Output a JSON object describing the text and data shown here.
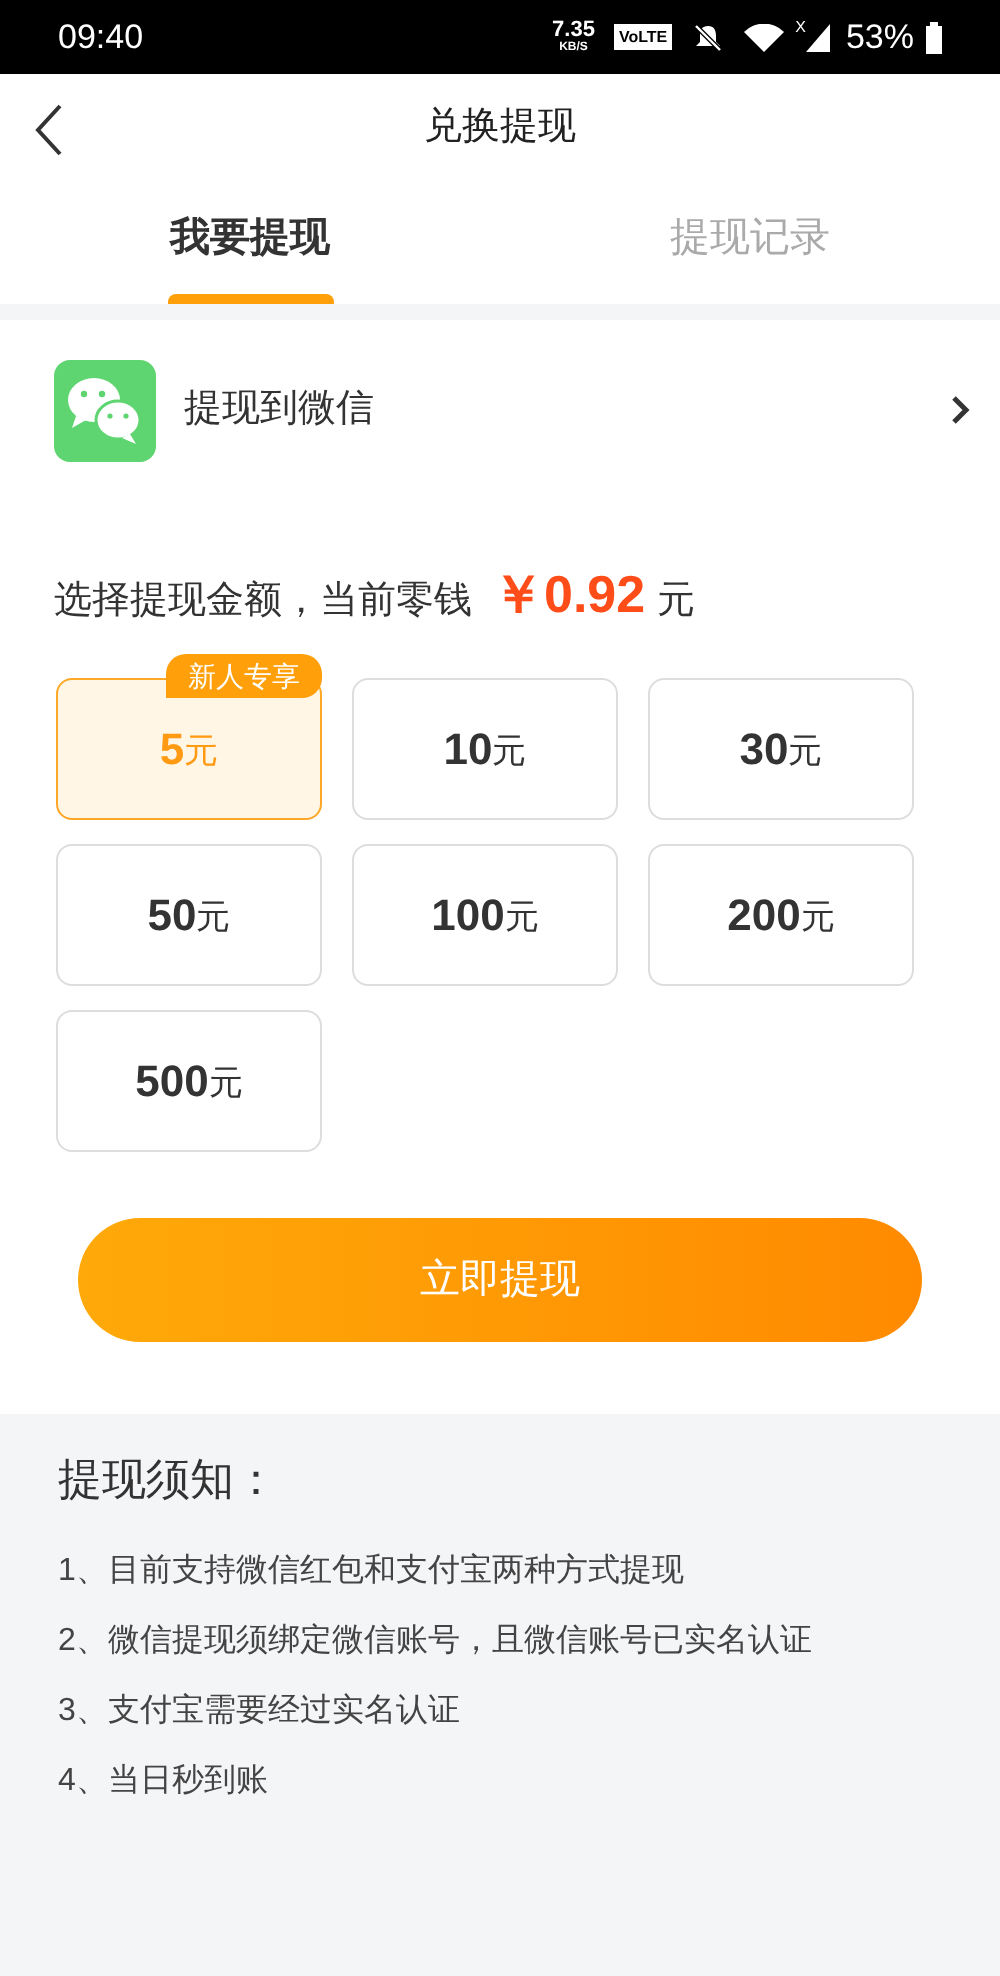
{
  "status_bar": {
    "time": "09:40",
    "speed": "7.35",
    "speed_unit": "KB/S",
    "network_badge": "VoLTE",
    "signal_mark": "X",
    "battery": "53%"
  },
  "header": {
    "title": "兑换提现"
  },
  "tabs": [
    {
      "label": "我要提现",
      "selected": true
    },
    {
      "label": "提现记录",
      "selected": false
    }
  ],
  "method": {
    "label": "提现到微信"
  },
  "balance": {
    "label": "选择提现金额，当前零钱",
    "amount": "￥0.92",
    "unit": "元"
  },
  "options": [
    {
      "amount": "5",
      "unit": "元",
      "selected": true,
      "badge": "新人专享"
    },
    {
      "amount": "10",
      "unit": "元",
      "selected": false
    },
    {
      "amount": "30",
      "unit": "元",
      "selected": false
    },
    {
      "amount": "50",
      "unit": "元",
      "selected": false
    },
    {
      "amount": "100",
      "unit": "元",
      "selected": false
    },
    {
      "amount": "200",
      "unit": "元",
      "selected": false
    },
    {
      "amount": "500",
      "unit": "元",
      "selected": false
    }
  ],
  "submit_button": "立即提现",
  "notes": {
    "title": "提现须知：",
    "items": [
      "1、目前支持微信红包和支付宝两种方式提现",
      "2、微信提现须绑定微信账号，且微信账号已实名认证",
      "3、支付宝需要经过实名认证",
      "4、当日秒到账"
    ]
  }
}
